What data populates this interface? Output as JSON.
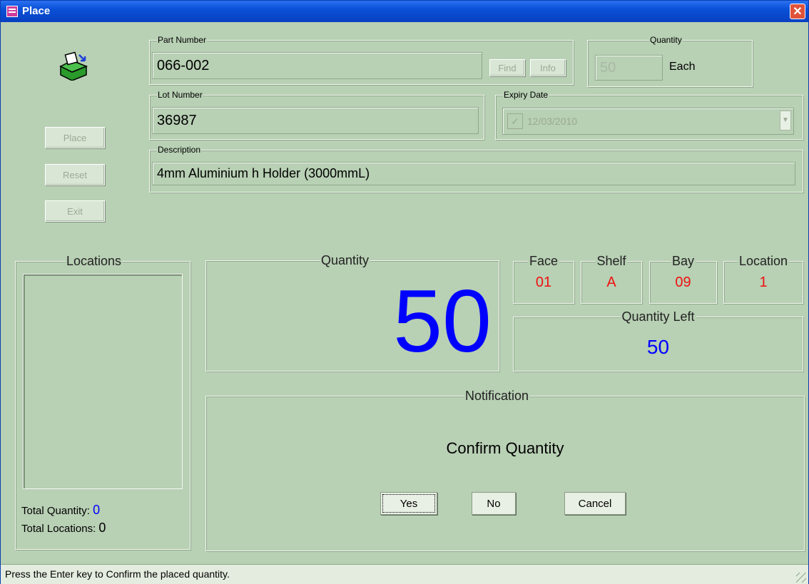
{
  "window": {
    "title": "Place",
    "close_symbol": "✕"
  },
  "actions": {
    "place": "Place",
    "reset": "Reset",
    "exit": "Exit"
  },
  "part": {
    "caption": "Part Number",
    "value": "066-002",
    "find": "Find",
    "info": "Info"
  },
  "quantity_box": {
    "caption": "Quantity",
    "value": "50",
    "unit": "Each"
  },
  "lot": {
    "caption": "Lot Number",
    "value": "36987"
  },
  "expiry": {
    "caption": "Expiry Date",
    "checked": true,
    "value": "12/03/2010",
    "check_symbol": "✓",
    "dropdown_symbol": "▼"
  },
  "description": {
    "caption": "Description",
    "value": "4mm Aluminium h Holder (3000mmL)"
  },
  "locations": {
    "caption": "Locations",
    "total_quantity_label": "Total Quantity:",
    "total_quantity": "0",
    "total_locations_label": "Total Locations:",
    "total_locations": "0"
  },
  "big_quantity": {
    "caption": "Quantity",
    "value": "50"
  },
  "position": {
    "face_label": "Face",
    "face": "01",
    "shelf_label": "Shelf",
    "shelf": "A",
    "bay_label": "Bay",
    "bay": "09",
    "location_label": "Location",
    "location": "1"
  },
  "quantity_left": {
    "caption": "Quantity Left",
    "value": "50"
  },
  "notification": {
    "caption": "Notification",
    "message": "Confirm Quantity",
    "yes": "Yes",
    "no": "No",
    "cancel": "Cancel"
  },
  "status": {
    "text": "Press the Enter key to Confirm the placed quantity."
  },
  "colors": {
    "window_bg": "#b8d0b4",
    "accent_blue": "#0000ff",
    "value_red": "#f01010"
  }
}
